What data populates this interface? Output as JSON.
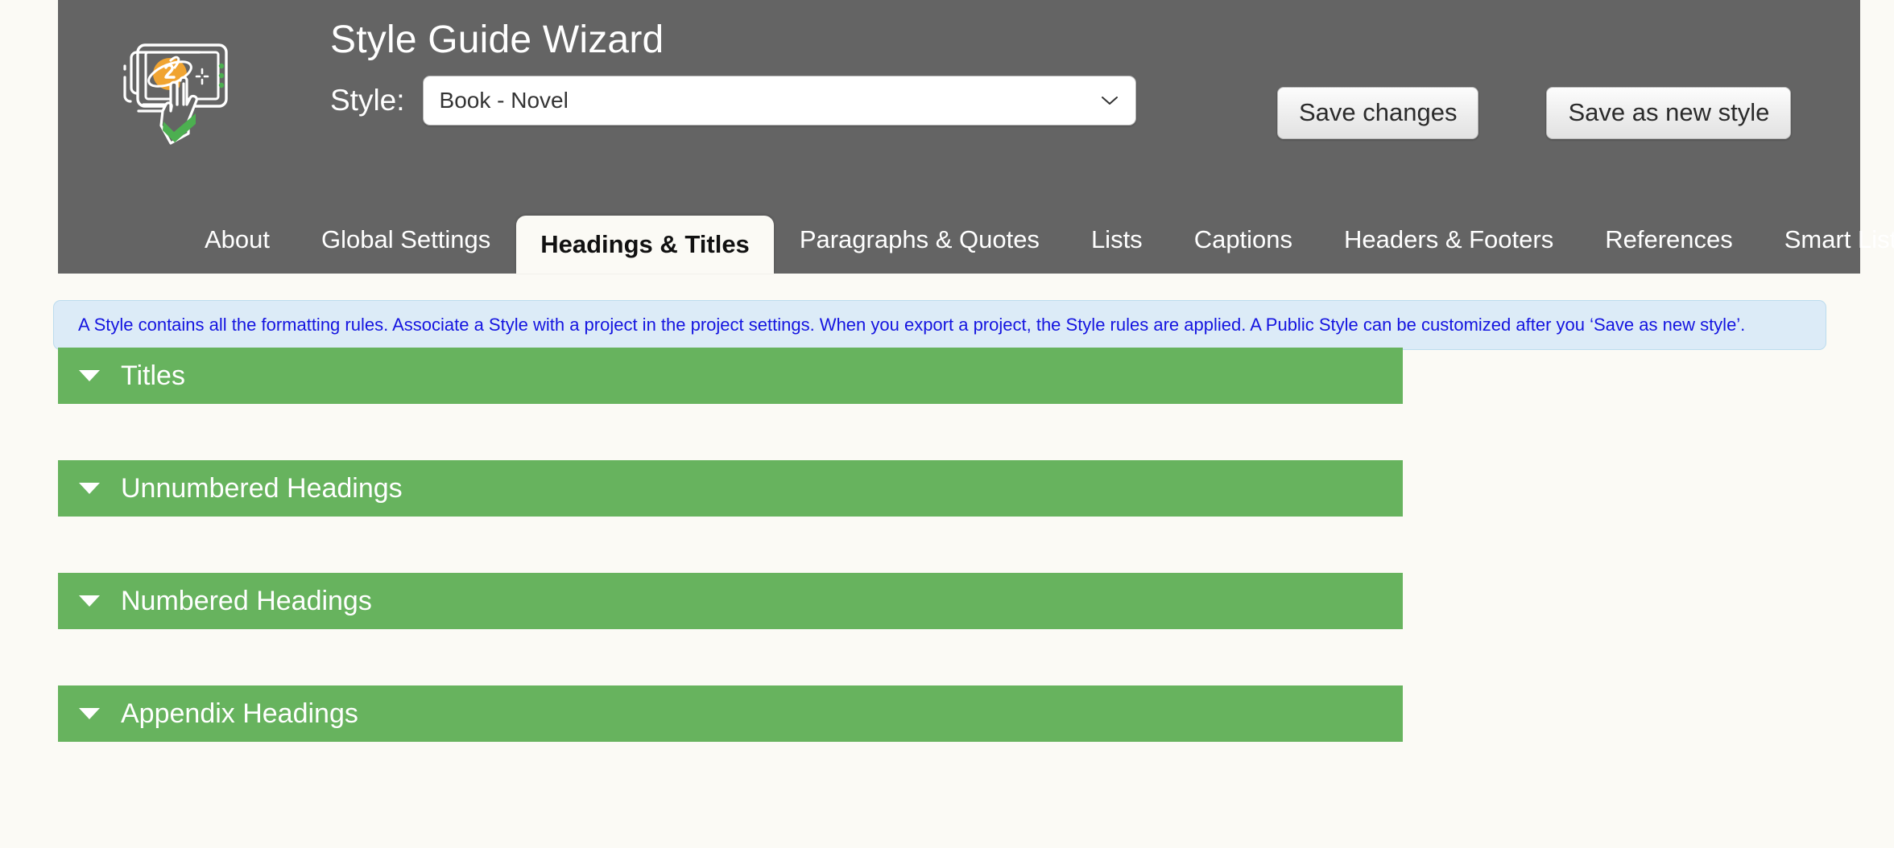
{
  "header": {
    "title": "Style Guide Wizard",
    "logo_icon": "tablet-planet-touch-icon",
    "style_label": "Style:",
    "style_select": {
      "value": "Book - Novel",
      "chevron_icon": "chevron-down-icon"
    },
    "buttons": [
      {
        "label": "Save changes",
        "name": "save-changes-button"
      },
      {
        "label": "Save as new style",
        "name": "save-as-new-style-button"
      }
    ],
    "background_color": "#646464"
  },
  "tabs": [
    {
      "label": "About",
      "active": false
    },
    {
      "label": "Global Settings",
      "active": false
    },
    {
      "label": "Headings & Titles",
      "active": true
    },
    {
      "label": "Paragraphs & Quotes",
      "active": false
    },
    {
      "label": "Lists",
      "active": false
    },
    {
      "label": "Captions",
      "active": false
    },
    {
      "label": "Headers & Footers",
      "active": false
    },
    {
      "label": "References",
      "active": false
    },
    {
      "label": "Smart Lists",
      "active": false
    }
  ],
  "info_banner": {
    "text": "A Style contains all the formatting rules. Associate a Style with a project in the project settings. When you export a project, the Style rules are applied. A Public Style can be customized after you ‘Save as new style’.",
    "text_color": "#1414e0",
    "background_color": "#dcebf7"
  },
  "panels": [
    {
      "label": "Titles",
      "arrow_icon": "triangle-down-icon",
      "expanded": false
    },
    {
      "label": "Unnumbered Headings",
      "arrow_icon": "triangle-down-icon",
      "expanded": false
    },
    {
      "label": "Numbered Headings",
      "arrow_icon": "triangle-down-icon",
      "expanded": false
    },
    {
      "label": "Appendix Headings",
      "arrow_icon": "triangle-down-icon",
      "expanded": false
    }
  ],
  "colors": {
    "panel_green": "#67b35e",
    "page_background": "#fbfaf5",
    "accent_orange": "#f0a431",
    "accent_green": "#4caf50"
  }
}
